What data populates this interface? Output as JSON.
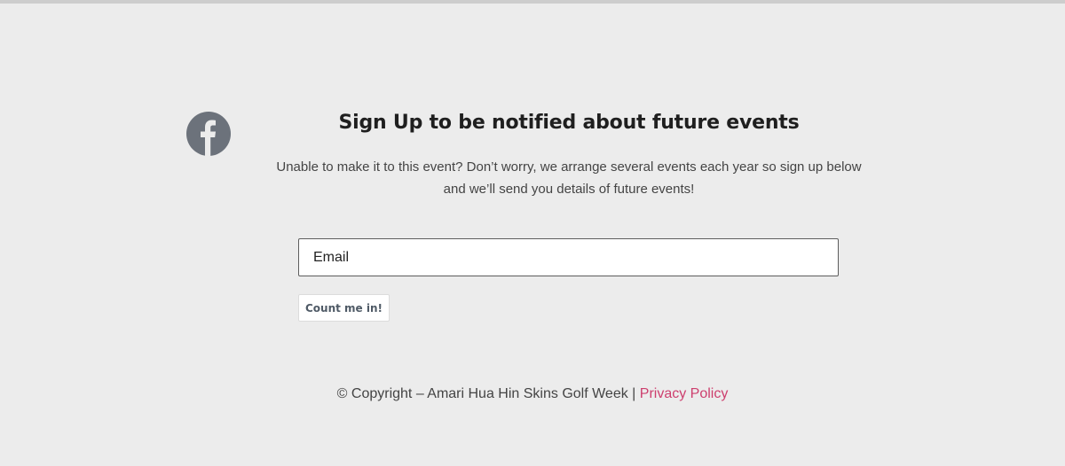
{
  "header": {
    "social_icon": "facebook-icon"
  },
  "signup": {
    "title": "Sign Up to be notified about future events",
    "description": "Unable to make it to this event?  Don’t worry, we arrange several events each year so sign up below and we’ll send you details of future events!",
    "email_placeholder": "Email",
    "submit_label": "Count me in!"
  },
  "footer": {
    "copyright_text": "© Copyright – Amari Hua Hin Skins Golf Week | ",
    "privacy_label": "Privacy Policy"
  },
  "colors": {
    "background": "#ececec",
    "icon": "#6c727b",
    "link": "#cd3f6e"
  }
}
